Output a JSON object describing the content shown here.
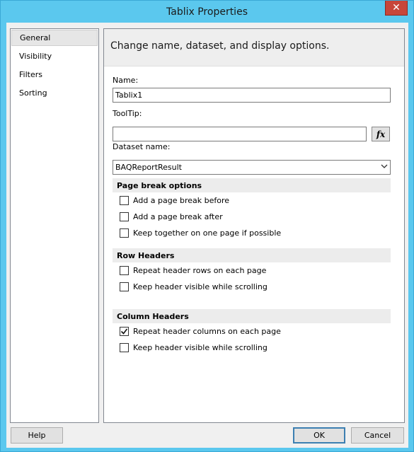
{
  "window": {
    "title": "Tablix Properties",
    "close_glyph": "✕"
  },
  "nav": {
    "items": [
      {
        "label": "General",
        "selected": true
      },
      {
        "label": "Visibility",
        "selected": false
      },
      {
        "label": "Filters",
        "selected": false
      },
      {
        "label": "Sorting",
        "selected": false
      }
    ]
  },
  "content": {
    "header": "Change name, dataset, and display options.",
    "name_label": "Name:",
    "name_value": "Tablix1",
    "tooltip_label": "ToolTip:",
    "tooltip_value": "",
    "fx_label": "fx",
    "dataset_label": "Dataset name:",
    "dataset_value": "BAQReportResult",
    "page_break": {
      "title": "Page break options",
      "options": [
        {
          "label": "Add a page break before",
          "checked": false
        },
        {
          "label": "Add a page break after",
          "checked": false
        },
        {
          "label": "Keep together on one page if possible",
          "checked": false
        }
      ]
    },
    "row_headers": {
      "title": "Row Headers",
      "options": [
        {
          "label": "Repeat header rows on each page",
          "checked": false
        },
        {
          "label": "Keep header visible while scrolling",
          "checked": false
        }
      ]
    },
    "column_headers": {
      "title": "Column Headers",
      "options": [
        {
          "label": "Repeat header columns on each page",
          "checked": true
        },
        {
          "label": "Keep header visible while scrolling",
          "checked": false
        }
      ]
    }
  },
  "buttons": {
    "help": "Help",
    "ok": "OK",
    "cancel": "Cancel"
  },
  "icons": {
    "dropdown": "chevron-down-icon",
    "check": "checkmark-icon"
  },
  "colors": {
    "titlebar": "#5bc8ee",
    "close": "#c7463a",
    "default_button_border": "#3c7fb1"
  }
}
